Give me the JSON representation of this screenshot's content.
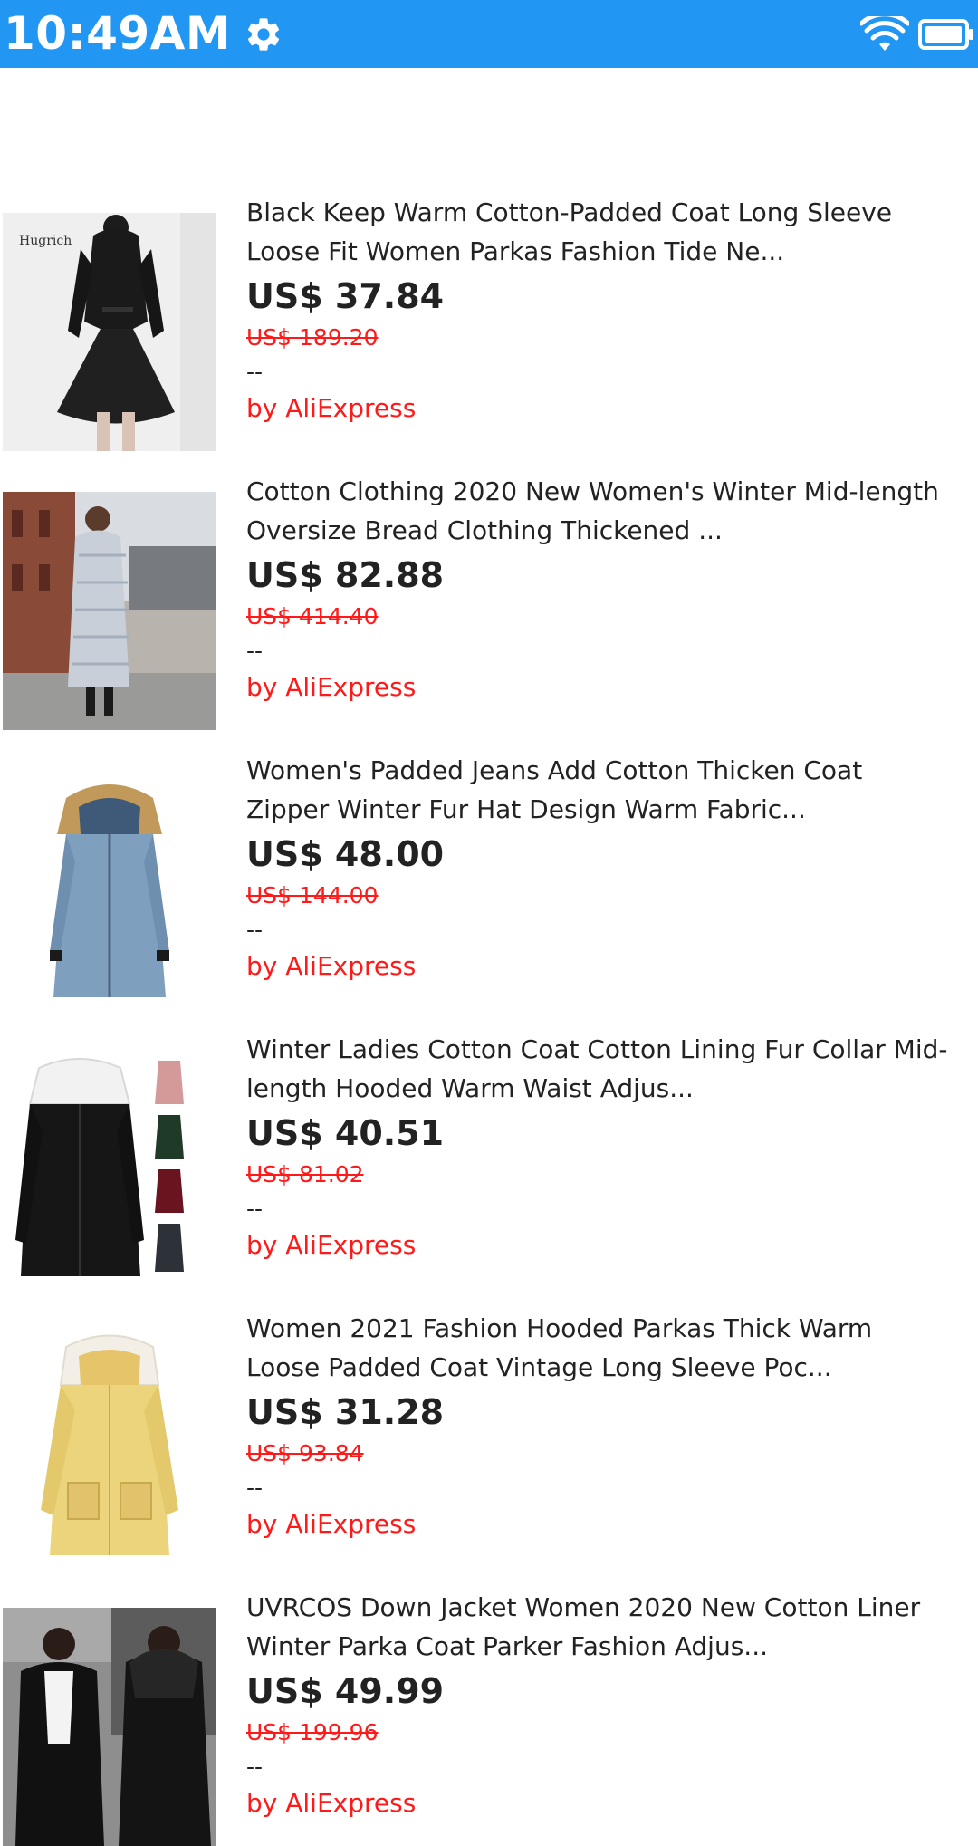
{
  "status_bar": {
    "time": "10:49AM",
    "background": "#2196F3",
    "icons": [
      "gear-icon",
      "wifi-icon",
      "battery-icon"
    ]
  },
  "products": [
    {
      "title_line1": "Black Keep Warm Cotton-Padded Coat Long Sleeve",
      "title_line2": "Loose Fit Women Parkas Fashion Tide Ne...",
      "price": "US$ 37.84",
      "original_price": "US$ 189.20",
      "rating": "--",
      "seller": "by AliExpress",
      "image_caption": "Hugrich"
    },
    {
      "title_line1": "Cotton Clothing 2020 New Women's Winter Mid-length",
      "title_line2": "Oversize Bread Clothing Thickened ...",
      "price": "US$ 82.88",
      "original_price": "US$ 414.40",
      "rating": "--",
      "seller": "by AliExpress"
    },
    {
      "title_line1": "Women's Padded Jeans Add Cotton Thicken Coat",
      "title_line2": "Zipper Winter Fur Hat Design Warm Fabric...",
      "price": "US$ 48.00",
      "original_price": "US$ 144.00",
      "rating": "--",
      "seller": "by AliExpress"
    },
    {
      "title_line1": "Winter Ladies Cotton Coat Cotton Lining Fur Collar Mid-",
      "title_line2": "length Hooded Warm Waist Adjus...",
      "price": "US$ 40.51",
      "original_price": "US$ 81.02",
      "rating": "--",
      "seller": "by AliExpress"
    },
    {
      "title_line1": "Women 2021 Fashion Hooded Parkas Thick Warm",
      "title_line2": "Loose Padded Coat Vintage Long Sleeve Poc...",
      "price": "US$ 31.28",
      "original_price": "US$ 93.84",
      "rating": "--",
      "seller": "by AliExpress"
    },
    {
      "title_line1": "UVRCOS Down Jacket Women 2020 New Cotton Liner",
      "title_line2": "Winter Parka Coat Parker Fashion Adjus...",
      "price": "US$ 49.99",
      "original_price": "US$ 199.96",
      "rating": "--",
      "seller": "by AliExpress"
    }
  ]
}
